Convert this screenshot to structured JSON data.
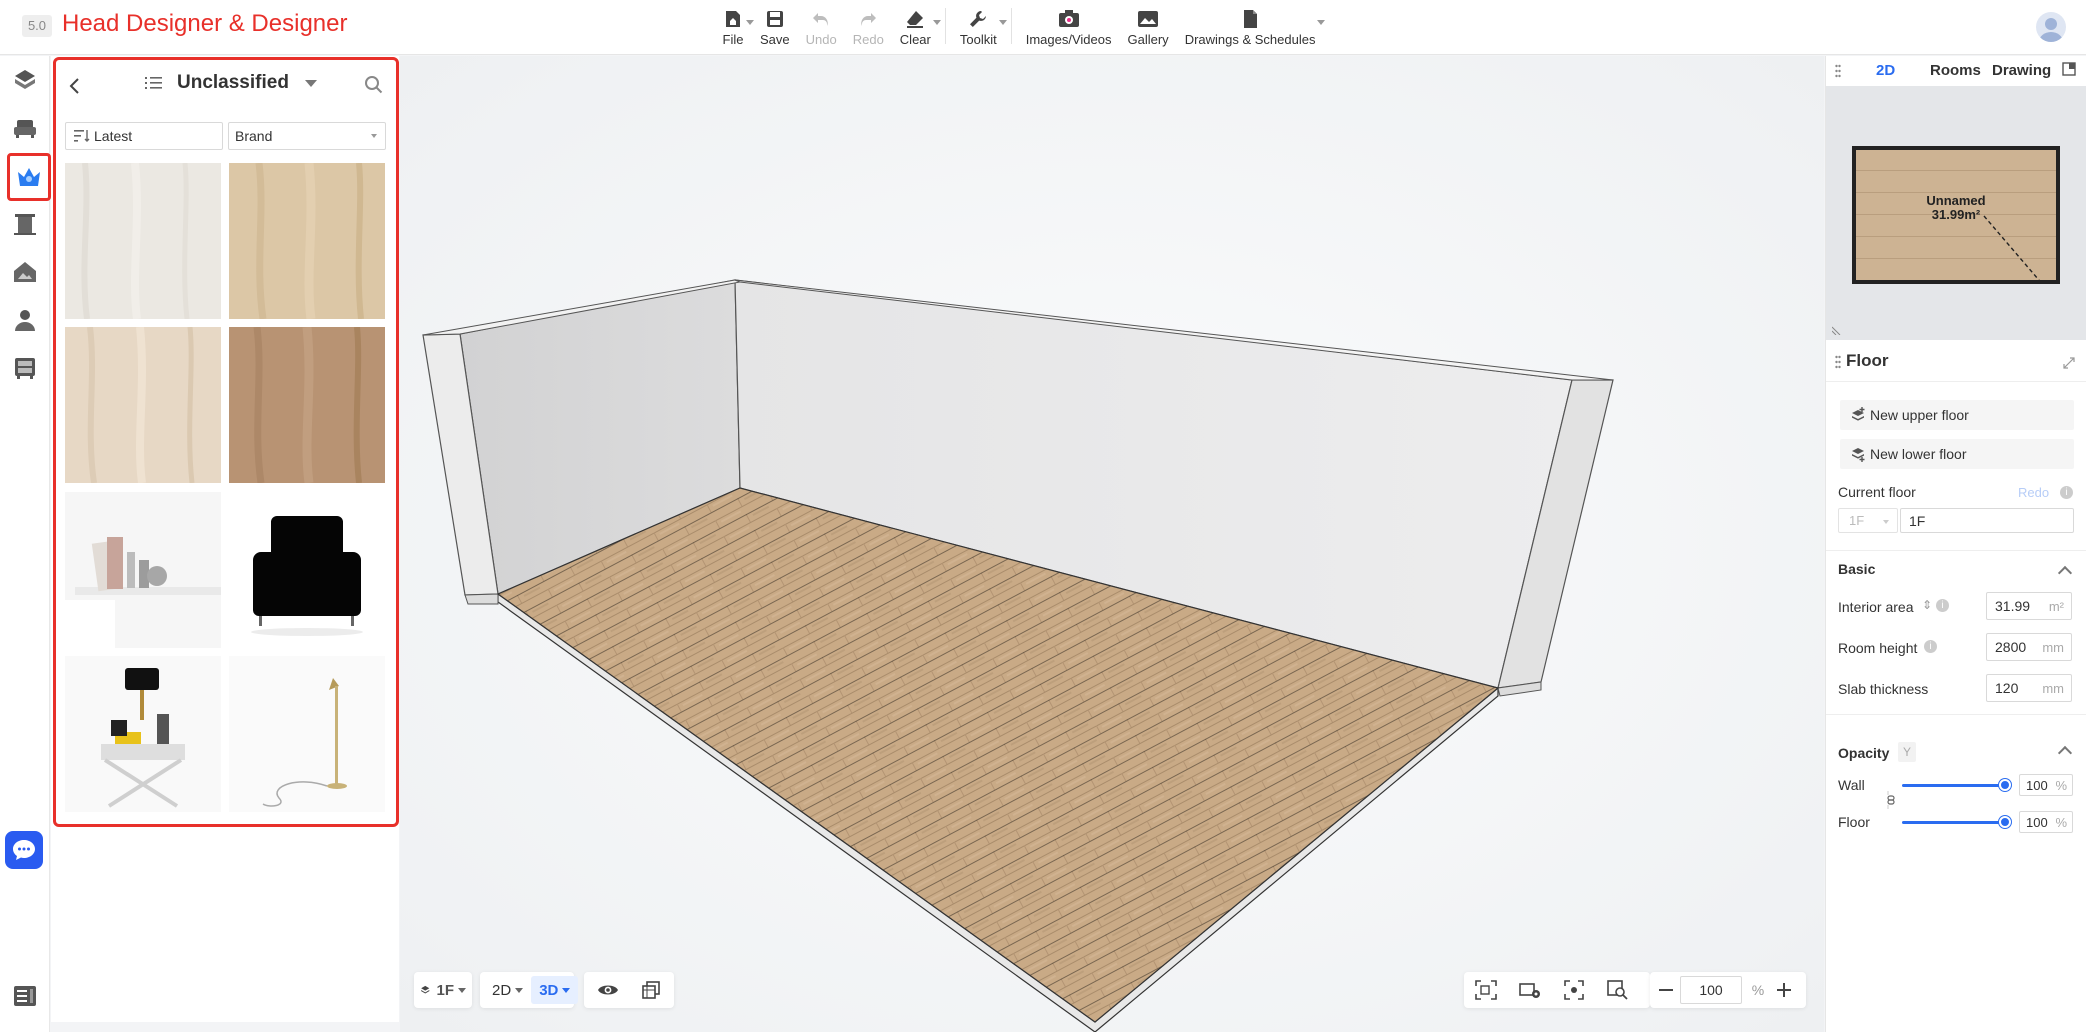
{
  "app": {
    "version": "5.0",
    "title": "Head Designer & Designer"
  },
  "toolbar": {
    "items": [
      {
        "label": "File",
        "icon": "home-file-icon",
        "caret": true
      },
      {
        "label": "Save",
        "icon": "save-icon",
        "caret": false
      },
      {
        "label": "Undo",
        "icon": "undo-icon",
        "caret": false,
        "disabled": true
      },
      {
        "label": "Redo",
        "icon": "redo-icon",
        "caret": false,
        "disabled": true
      },
      {
        "label": "Clear",
        "icon": "eraser-icon",
        "caret": true
      },
      {
        "label": "Toolkit",
        "icon": "wrench-icon",
        "caret": true
      },
      {
        "label": "Images/Videos",
        "icon": "camera-icon",
        "caret": false
      },
      {
        "label": "Gallery",
        "icon": "gallery-icon",
        "caret": false
      },
      {
        "label": "Drawings & Schedules",
        "icon": "document-icon",
        "caret": true
      }
    ]
  },
  "rail": {
    "items": [
      "cube-icon",
      "sofa-icon",
      "crown-icon",
      "door-icon",
      "house-icon",
      "user-icon",
      "cabinet-icon"
    ],
    "active_index": 2
  },
  "library": {
    "category": "Unclassified",
    "sort_label": "Latest",
    "brand_label": "Brand",
    "thumbnails": [
      "white-wood-texture",
      "light-oak-texture",
      "pale-wood-texture",
      "brown-wood-texture",
      "shelf-decor-model",
      "armchair-model",
      "table-lamp-set-model",
      "floor-lamp-model"
    ]
  },
  "viewport": {
    "floor_label": "1F",
    "view_2d_label": "2D",
    "view_3d_label": "3D",
    "active_view": "3D",
    "zoom_value": "100",
    "zoom_unit": "%"
  },
  "right_panel": {
    "tabs": [
      "2D",
      "Rooms",
      "Drawing"
    ],
    "active_tab": "2D",
    "minimap": {
      "room_name": "Unnamed",
      "room_area": "31.99m²"
    },
    "floor_title": "Floor",
    "new_upper_floor": "New upper floor",
    "new_lower_floor": "New lower floor",
    "current_floor_label": "Current floor",
    "redo_label": "Redo",
    "current_floor_select": "1F",
    "current_floor_value": "1F",
    "basic": {
      "title": "Basic",
      "interior_area_label": "Interior area",
      "interior_area_value": "31.99",
      "interior_area_unit": "m²",
      "room_height_label": "Room height",
      "room_height_value": "2800",
      "room_height_unit": "mm",
      "slab_thickness_label": "Slab thickness",
      "slab_thickness_value": "120",
      "slab_thickness_unit": "mm"
    },
    "opacity": {
      "title": "Opacity",
      "shortcut": "Y",
      "wall_label": "Wall",
      "wall_value": "100",
      "floor_label": "Floor",
      "floor_value": "100",
      "unit": "%"
    }
  },
  "colors": {
    "accent": "#2a6cf0",
    "brand_red": "#e8302a",
    "floor_wood": "#c9aa86"
  }
}
